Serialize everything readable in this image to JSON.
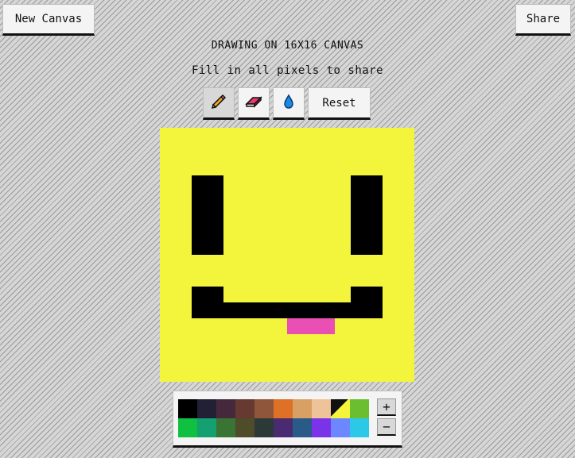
{
  "header": {
    "new_canvas_label": "New Canvas",
    "share_label": "Share",
    "title": "DRAWING ON 16X16 CANVAS",
    "subtitle": "Fill in all pixels to share"
  },
  "toolbar": {
    "tools": [
      {
        "name": "pencil",
        "icon": "pencil-icon",
        "active": true
      },
      {
        "name": "eraser",
        "icon": "eraser-icon",
        "active": false
      },
      {
        "name": "fill",
        "icon": "droplet-icon",
        "active": false
      }
    ],
    "reset_label": "Reset"
  },
  "canvas": {
    "width": 16,
    "height": 16,
    "colors": {
      "Y": "#f2f53c",
      "K": "#000000",
      "P": "#ea4fb4"
    },
    "rows": [
      "YYYYYYYYYYYYYYYY",
      "YYYYYYYYYYYYYYYY",
      "YYYYYYYYYYYYYYYY",
      "YYKKYYYYYYYYKKYY",
      "YYKKYYYYYYYYKKYY",
      "YYKKYYYYYYYYKKYY",
      "YYKKYYYYYYYYKKYY",
      "YYKKYYYYYYYYKKYY",
      "YYYYYYYYYYYYYYYY",
      "YYYYYYYYYYYYYYYY",
      "YYKKYYYYYYYYKKYY",
      "YYKKKKKKKKKKKKYY",
      "YYYYYYYYPPPYYYYY",
      "YYYYYYYYYYYYYYYY",
      "YYYYYYYYYYYYYYYY",
      "YYYYYYYYYYYYYYYY"
    ]
  },
  "palette": {
    "selected_index": 8,
    "colors": [
      "#000000",
      "#222034",
      "#45283c",
      "#663931",
      "#8f563b",
      "#df7126",
      "#d9a066",
      "#eec39a",
      "#fbf236",
      "#6abe30",
      "#10c040",
      "#14a070",
      "#3a7434",
      "#4f4c2a",
      "#2b3a36",
      "#4a2a70",
      "#2a5a88",
      "#7a33e8",
      "#6c87ff",
      "#2cc8e8"
    ],
    "zoom_in_label": "+",
    "zoom_out_label": "−"
  }
}
